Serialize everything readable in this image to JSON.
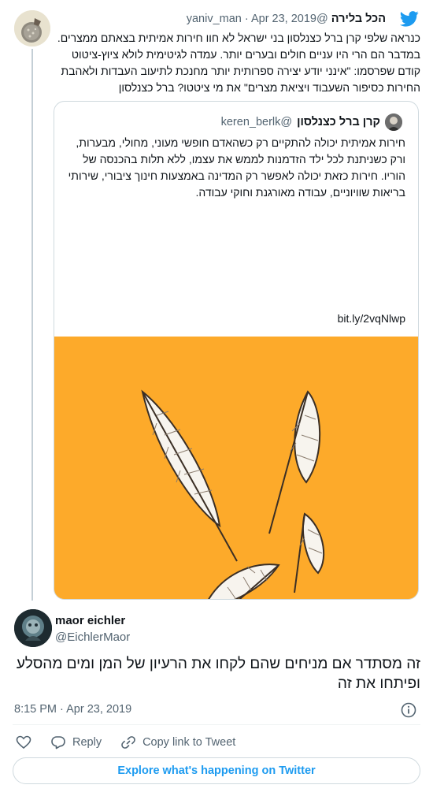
{
  "parent": {
    "display_name": "הכל בלירה",
    "handle": "@yaniv_man",
    "separator": "·",
    "date": "Apr 23, 2019",
    "text": "כנראה שלפי קרן ברל כצנלסון בני ישראל לא חוו חירות אמיתית בצאתם ממצרים. במדבר הם הרי היו עניים חולים ובערים יותר. עמדה לגיטימית לולא ציוץ-ציטוט קודם שפרסמו: \"אינני יודע יצירה ספרותית יותר מחנכת לתיעוב העבדות ולאהבת החירות כסיפור השעבוד ויציאת מצרים\" את מי ציטטו? ברל כצנלסון"
  },
  "quote": {
    "display_name": "קרן ברל כצנלסון",
    "handle": "@keren_berlk",
    "text": "חירות אמיתית יכולה להתקיים רק כשהאדם חופשי מעוני, מחולי, מבערות, ורק כשניתנת לכל ילד הזדמנות לממש את עצמו, ללא תלות בהכנסה של הוריו. חירות כזאת יכולה לאפשר רק המדינה באמצעות חינוך ציבורי, שירותי בריאות שוויוניים, עבודה מאורגנת וחוקי עבודה.",
    "link": "bit.ly/2vqNlwp"
  },
  "reply": {
    "display_name": "maor eichler",
    "handle": "@EichlerMaor",
    "text": "זה מסתדר אם מניחים שהם לקחו את הרעיון של המן ומים מהסלע ופיתחו את זה",
    "time": "8:15 PM",
    "separator": "·",
    "date": "Apr 23, 2019"
  },
  "actions": {
    "reply_label": "Reply",
    "copy_label": "Copy link to Tweet"
  },
  "explore_label": "Explore what's happening on Twitter",
  "colors": {
    "twitter_blue": "#1d9bf0",
    "image_background": "#fdaa2a",
    "secondary_text": "#536471"
  },
  "icons": [
    "twitter-bird-icon",
    "info-icon",
    "heart-icon",
    "reply-icon",
    "link-icon"
  ]
}
